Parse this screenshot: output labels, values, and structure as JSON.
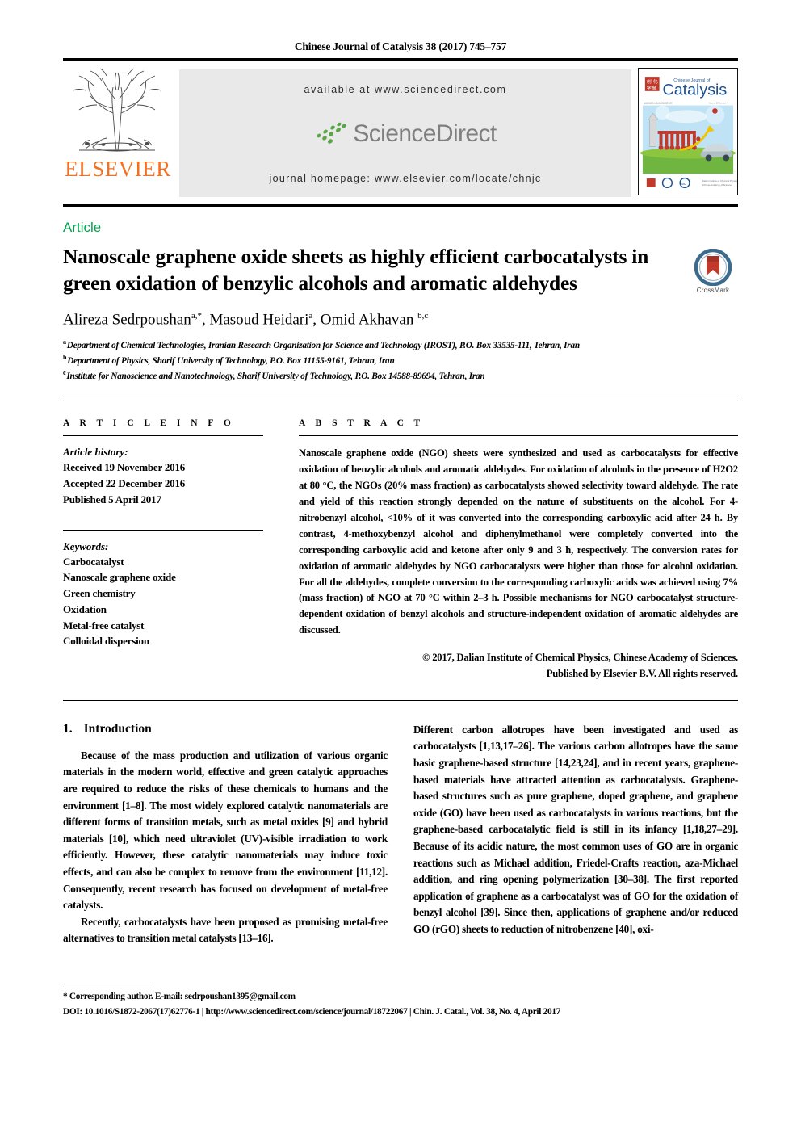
{
  "running_head": "Chinese Journal of Catalysis 38 (2017) 745–757",
  "masthead": {
    "publisher_name": "ELSEVIER",
    "available_at": "available at www.sciencedirect.com",
    "sciencedirect_word": "ScienceDirect",
    "journal_homepage": "journal homepage: www.elsevier.com/locate/chnjc",
    "cover": {
      "masthead_small": "Chinese Journal of",
      "masthead_main": "Catalysis"
    }
  },
  "article_type": "Article",
  "title": "Nanoscale graphene oxide sheets as highly efficient carbocatalysts in green oxidation of benzylic alcohols and aromatic aldehydes",
  "crossmark_label": "CrossMark",
  "authors": [
    {
      "name": "Alireza Sedrpoushan",
      "marks": "a,*"
    },
    {
      "name": "Masoud Heidari",
      "marks": "a"
    },
    {
      "name": "Omid Akhavan",
      "marks": "b,c"
    }
  ],
  "affiliations": [
    {
      "mark": "a",
      "text": "Department of Chemical Technologies, Iranian Research Organization for Science and Technology (IROST), P.O. Box 33535-111, Tehran, Iran"
    },
    {
      "mark": "b",
      "text": "Department of Physics, Sharif University of Technology, P.O. Box 11155-9161, Tehran, Iran"
    },
    {
      "mark": "c",
      "text": "Institute for Nanoscience and Nanotechnology, Sharif University of Technology, P.O. Box 14588-89694, Tehran, Iran"
    }
  ],
  "article_info": {
    "heading": "A R T I C L E   I N F O",
    "history_label": "Article history:",
    "history": [
      "Received 19 November 2016",
      "Accepted 22 December 2016",
      "Published 5 April 2017"
    ],
    "keywords_label": "Keywords:",
    "keywords": [
      "Carbocatalyst",
      "Nanoscale graphene oxide",
      "Green chemistry",
      "Oxidation",
      "Metal-free catalyst",
      "Colloidal dispersion"
    ]
  },
  "abstract": {
    "heading": "A B S T R A C T",
    "body": "Nanoscale graphene oxide (NGO) sheets were synthesized and used as carbocatalysts for effective oxidation of benzylic alcohols and aromatic aldehydes. For oxidation of alcohols in the presence of H2O2 at 80 °C, the NGOs (20% mass fraction) as carbocatalysts showed selectivity toward aldehyde. The rate and yield of this reaction strongly depended on the nature of substituents on the alcohol. For 4-nitrobenzyl alcohol, <10% of it was converted into the corresponding carboxylic acid after 24 h. By contrast, 4-methoxybenzyl alcohol and diphenylmethanol were completely converted into the corresponding carboxylic acid and ketone after only 9 and 3 h, respectively. The conversion rates for oxidation of aromatic aldehydes by NGO carbocatalysts were higher than those for alcohol oxidation. For all the aldehydes, complete conversion to the corresponding carboxylic acids was achieved using 7% (mass fraction) of NGO at 70 °C within 2–3 h. Possible mechanisms for NGO carbocatalyst structure-dependent oxidation of benzyl alcohols and structure-independent oxidation of aromatic aldehydes are discussed.",
    "copyright_line1": "© 2017, Dalian Institute of Chemical Physics, Chinese Academy of Sciences.",
    "copyright_line2": "Published by Elsevier B.V. All rights reserved."
  },
  "body": {
    "section_number": "1.",
    "section_title": "Introduction",
    "left_paragraphs": [
      "Because of the mass production and utilization of various organic materials in the modern world, effective and green catalytic approaches are required to reduce the risks of these chemicals to humans and the environment [1–8]. The most widely explored catalytic nanomaterials are different forms of transition metals, such as metal oxides [9] and hybrid materials [10], which need ultraviolet (UV)-visible irradiation to work efficiently. However, these catalytic nanomaterials may induce toxic effects, and can also be complex to remove from the environment [11,12]. Consequently, recent research has focused on development of metal-free catalysts.",
      "Recently, carbocatalysts have been proposed as promising metal-free alternatives to transition metal catalysts [13–16]."
    ],
    "right_paragraphs": [
      "Different carbon allotropes have been investigated and used as carbocatalysts [1,13,17–26]. The various carbon allotropes have the same basic graphene-based structure [14,23,24], and in recent years, graphene-based materials have attracted attention as carbocatalysts. Graphene-based structures such as pure graphene, doped graphene, and graphene oxide (GO) have been used as carbocatalysts in various reactions, but the graphene-based carbocatalytic field is still in its infancy [1,18,27–29]. Because of its acidic nature, the most common uses of GO are in organic reactions such as Michael addition, Friedel-Crafts reaction, aza-Michael addition, and ring opening polymerization [30–38]. The first reported application of graphene as a carbocatalyst was of GO for the oxidation of benzyl alcohol [39]. Since then, applications of graphene and/or reduced GO (rGO) sheets to reduction of nitrobenzene [40], oxi-"
    ]
  },
  "footer": {
    "corresponding": "* Corresponding author. E-mail: sedrpoushan1395@gmail.com",
    "doi_line": "DOI: 10.1016/S1872-2067(17)62776-1 | http://www.sciencedirect.com/science/journal/18722067 | Chin. J. Catal., Vol. 38, No. 4, April 2017"
  },
  "colors": {
    "elsevier_orange": "#f37021",
    "article_green": "#00a551",
    "sciencedirect_gray": "#7f7f7f",
    "sciencedirect_green": "#5aa546",
    "band_gray": "#e9e9e9"
  }
}
